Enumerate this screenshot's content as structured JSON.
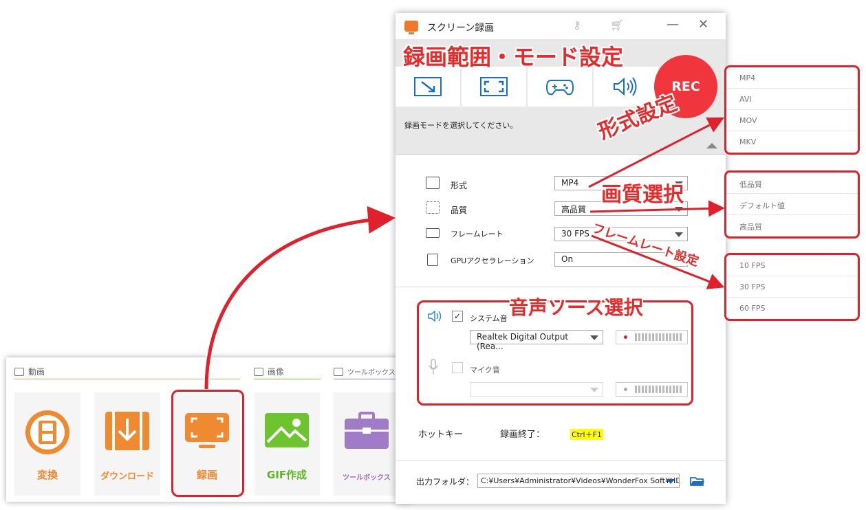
{
  "launcher": {
    "categories": {
      "video": "動画",
      "image": "画像",
      "tools": "ツールボックス"
    },
    "tiles": [
      {
        "label": "変換"
      },
      {
        "label": "ダウンロード"
      },
      {
        "label": "録画"
      },
      {
        "label": "GIF作成"
      },
      {
        "label": "ツールボックス"
      }
    ]
  },
  "window": {
    "title": "スクリーン録画",
    "rec_label": "REC",
    "mode_hint": "録画モードを選択してください。",
    "settings": {
      "format_label": "形式",
      "format_value": "MP4",
      "quality_label": "品質",
      "quality_value": "高品質",
      "fps_label": "フレームレート",
      "fps_value": "30 FPS",
      "gpu_label": "GPUアクセラレーション",
      "gpu_value": "On"
    },
    "audio": {
      "system_label": "システム音",
      "system_device": "Realtek Digital Output (Rea...",
      "mic_label": "マイク音"
    },
    "hotkey": {
      "label": "ホットキー",
      "action": "録画終了：",
      "keys": "Ctrl＋F1"
    },
    "output": {
      "label": "出力フォルダ：",
      "path": "C:¥Users¥Administrator¥Videos¥WonderFox Soft¥HD V"
    }
  },
  "options": {
    "formats": [
      "MP4",
      "AVI",
      "MOV",
      "MKV"
    ],
    "qualities": [
      "低品質",
      "デフォルト値",
      "高品質"
    ],
    "fps": [
      "10 FPS",
      "30 FPS",
      "60 FPS"
    ]
  },
  "callouts": {
    "mode": "録画範囲・モード設定",
    "format": "形式設定",
    "quality": "画質選択",
    "fps": "フレームレート設定",
    "audio": "音声ソース選択"
  },
  "colors": {
    "accent_red": "#e0202a",
    "rec_red": "#f0363c",
    "orange": "#f08a30",
    "green": "#5fb523",
    "purple": "#9a6cc4"
  }
}
